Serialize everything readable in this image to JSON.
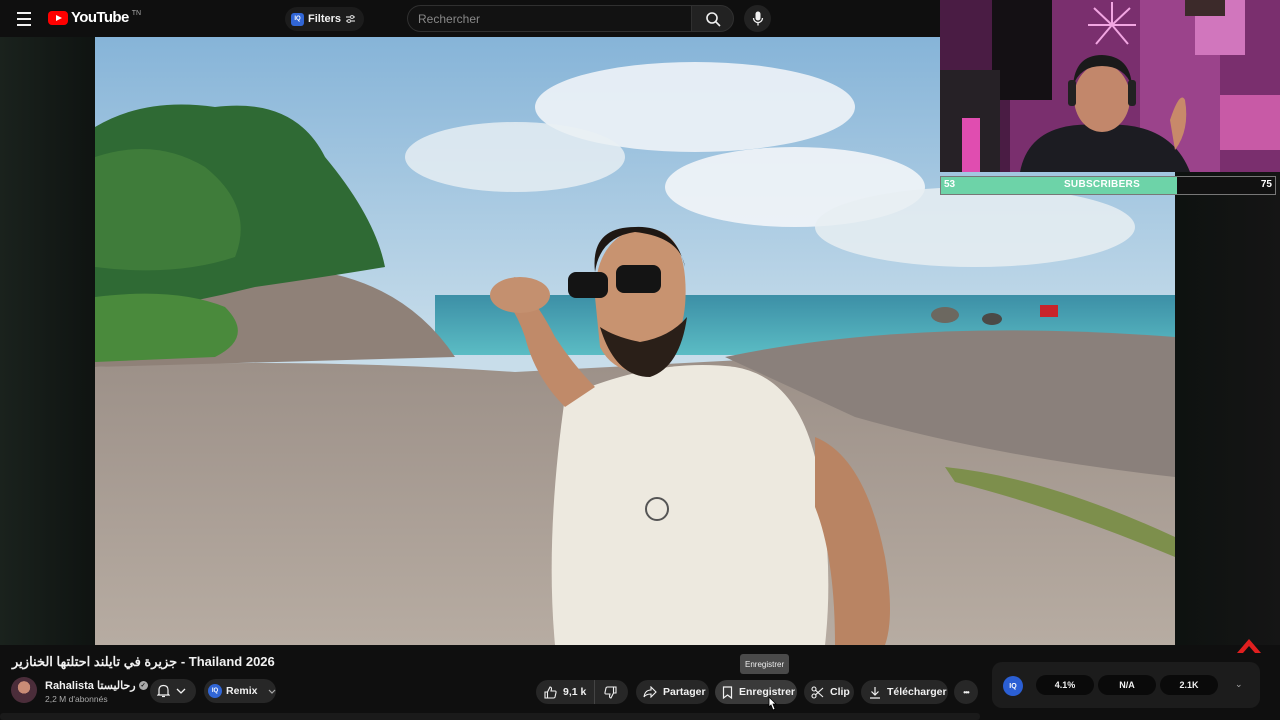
{
  "masthead": {
    "logo_text": "YouTube",
    "logo_tm": "TN",
    "filters_label": "Filters",
    "filters_badge": "IQ",
    "search_placeholder": "Rechercher"
  },
  "webcam": {
    "subscriber_goal": {
      "current": "53",
      "label": "SUBSCRIBERS",
      "target": "75",
      "progress": 0.7067
    }
  },
  "video": {
    "title": "جزيرة في تايلند احتلتها الخنازير - Thailand 2026",
    "channel": {
      "name": "Rahalista رحاليستا",
      "subscribers": "2,2 M d'abonnés"
    },
    "remix_label": "Remix",
    "remix_badge": "IQ",
    "likes": "9,1 k",
    "share_label": "Partager",
    "save_label": "Enregistrer",
    "save_tooltip": "Enregistrer",
    "clip_label": "Clip",
    "download_label": "Télécharger",
    "more_label": "•••"
  },
  "stats_panel": {
    "badge": "IQ",
    "values": [
      "4.1%",
      "N/A",
      "2.1K"
    ]
  },
  "colors": {
    "youtube_red": "#ff0000",
    "subscriber_fill": "#6dd3a8",
    "iq_blue": "#2b5fd4"
  }
}
